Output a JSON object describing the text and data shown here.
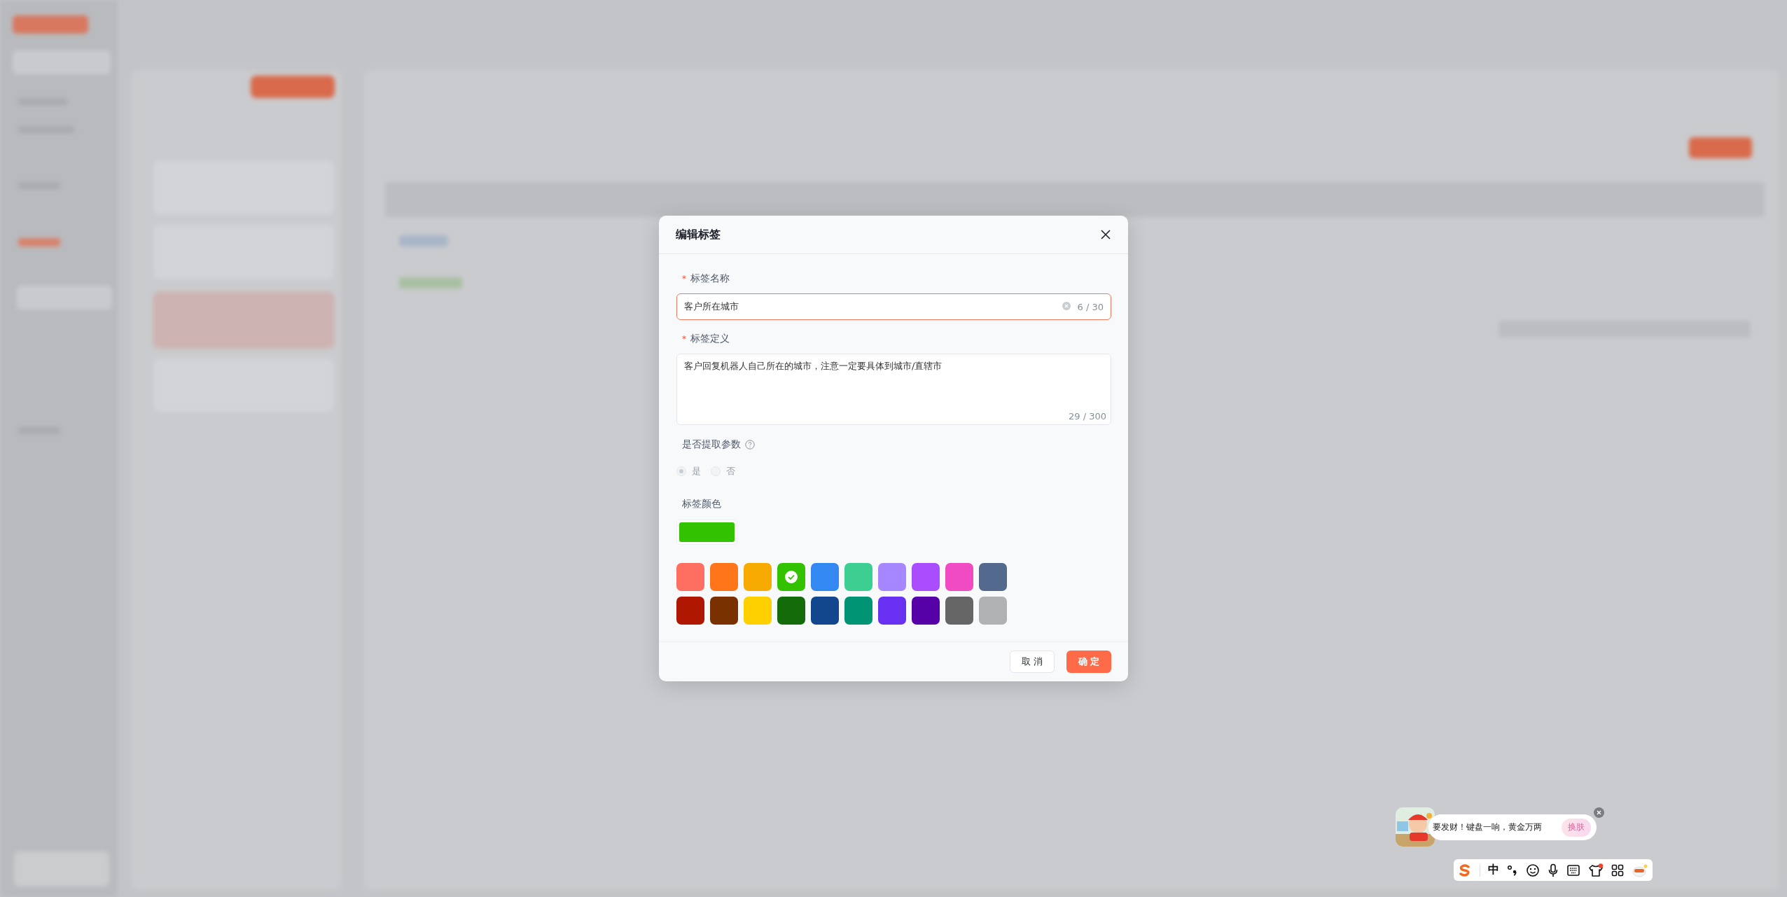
{
  "dialog": {
    "title": "编辑标签",
    "fields": [
      {
        "kind": "input",
        "required_mark": "*",
        "label": "标签名称",
        "value": "客户所在城市",
        "counter": "6 / 30",
        "focused": true
      },
      {
        "kind": "textarea",
        "required_mark": "*",
        "label": "标签定义",
        "value": "客户回复机器人自己所在的城市，注意一定要具体到城市/直辖市",
        "counter": "29 / 300",
        "focused": false
      }
    ],
    "extract_param": {
      "label": "是否提取参数",
      "disabled": true,
      "options": [
        {
          "label": "是",
          "selected": true
        },
        {
          "label": "否",
          "selected": false
        }
      ]
    },
    "color": {
      "label": "标签颜色",
      "color": "#33c200"
    },
    "swatches": [
      {
        "color": "#ff6f61",
        "selected": false
      },
      {
        "color": "#ff7519",
        "selected": false
      },
      {
        "color": "#f7ab00",
        "selected": false
      },
      {
        "color": "#33c200",
        "selected": true
      },
      {
        "color": "#3388f2",
        "selected": false
      },
      {
        "color": "#3ccf91",
        "selected": false
      },
      {
        "color": "#a787ff",
        "selected": false
      },
      {
        "color": "#a94dff",
        "selected": false
      },
      {
        "color": "#f04bc3",
        "selected": false
      },
      {
        "color": "#536a8e",
        "selected": false
      },
      {
        "color": "#b01700",
        "selected": false
      },
      {
        "color": "#7a3100",
        "selected": false
      },
      {
        "color": "#ffd000",
        "selected": false
      },
      {
        "color": "#136b0a",
        "selected": false
      },
      {
        "color": "#12468d",
        "selected": false
      },
      {
        "color": "#009474",
        "selected": false
      },
      {
        "color": "#6830f0",
        "selected": false
      },
      {
        "color": "#5600a8",
        "selected": false
      },
      {
        "color": "#666666",
        "selected": false
      },
      {
        "color": "#b0b1b3",
        "selected": false
      }
    ],
    "buttons": [
      {
        "kind": "default",
        "label": "取 消"
      },
      {
        "kind": "primary",
        "label": "确 定"
      }
    ]
  },
  "ime_popup": {
    "message": "要发财！键盘一响，黄金万两",
    "button": "换肤"
  },
  "ime_toolbar": {
    "mode": "中"
  }
}
